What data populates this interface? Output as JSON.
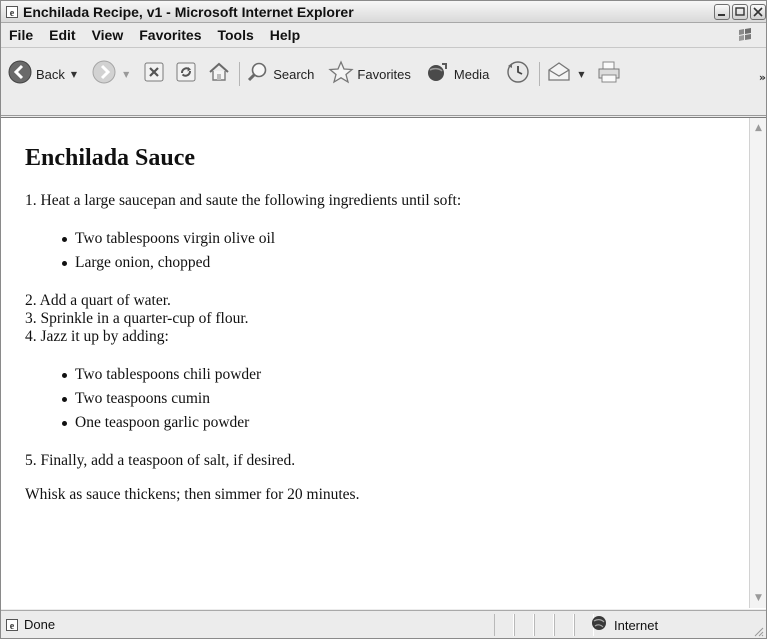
{
  "window": {
    "title": "Enchilada Recipe, v1 - Microsoft Internet Explorer",
    "controls": [
      "minimize-icon",
      "maximize-icon",
      "close-icon"
    ]
  },
  "menu": {
    "items": [
      "File",
      "Edit",
      "View",
      "Favorites",
      "Tools",
      "Help"
    ]
  },
  "toolbar": {
    "back_label": "Back",
    "search_label": "Search",
    "favorites_label": "Favorites",
    "media_label": "Media",
    "icons": [
      "back-icon",
      "forward-icon",
      "stop-icon",
      "refresh-icon",
      "home-icon",
      "search-icon",
      "favorites-icon",
      "media-icon",
      "history-icon",
      "mail-icon",
      "print-icon"
    ]
  },
  "page": {
    "heading": "Enchilada Sauce",
    "step1": "1. Heat a large saucepan and saute the following ingredients until soft:",
    "list1": [
      "Two tablespoons virgin olive oil",
      "Large onion, chopped"
    ],
    "step2": "2. Add a quart of water.",
    "step3": "3. Sprinkle in a quarter-cup of flour.",
    "step4": "4. Jazz it up by adding:",
    "list2": [
      "Two tablespoons chili powder",
      "Two teaspoons cumin",
      "One teaspoon garlic powder"
    ],
    "step5": "5. Finally, add a teaspoon of salt, if desired.",
    "closing": "Whisk as sauce thickens; then simmer for 20 minutes."
  },
  "status": {
    "text": "Done",
    "zone": "Internet"
  },
  "colors": {
    "chrome": "#ececec",
    "page_background": "#ffffff",
    "text": "#111111"
  }
}
